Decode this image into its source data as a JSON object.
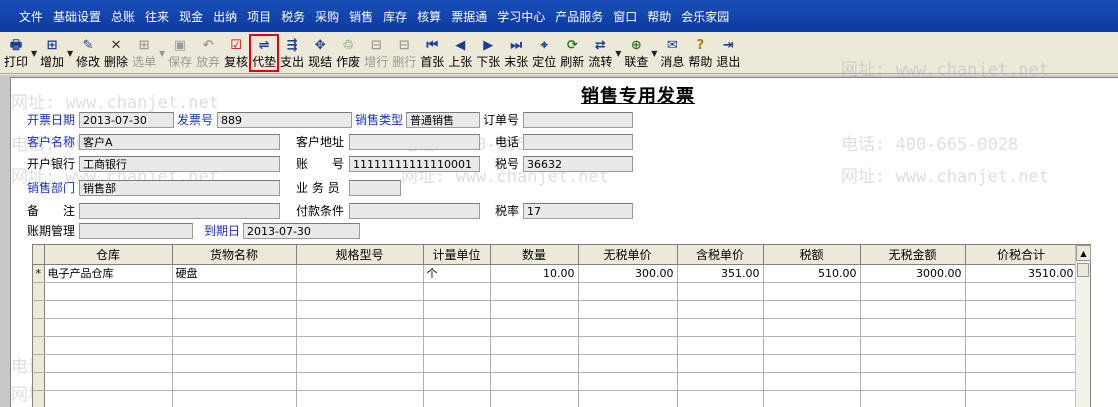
{
  "menu": [
    "文件",
    "基础设置",
    "总账",
    "往来",
    "现金",
    "出纳",
    "项目",
    "税务",
    "采购",
    "销售",
    "库存",
    "核算",
    "票据通",
    "学习中心",
    "产品服务",
    "窗口",
    "帮助",
    "会乐家园"
  ],
  "toolbar": {
    "print": "打印",
    "add": "增加",
    "modify": "修改",
    "delete": "删除",
    "select": "选单",
    "save": "保存",
    "discard": "放弃",
    "review": "复核",
    "advance": "代垫",
    "expense": "支出",
    "settle": "现结",
    "void": "作废",
    "add_row": "增行",
    "delete_row": "删行",
    "first": "首张",
    "prev": "上张",
    "next": "下张",
    "last": "末张",
    "locate": "定位",
    "refresh": "刷新",
    "flow": "流转",
    "link": "联查",
    "message": "消息",
    "help": "帮助",
    "exit": "退出"
  },
  "form": {
    "title": "销售专用发票",
    "invoice_date_label": "开票日期",
    "invoice_date": "2013-07-30",
    "invoice_no_label": "发票号",
    "invoice_no": "889",
    "sales_type_label": "销售类型",
    "sales_type": "普通销售",
    "order_no_label": "订单号",
    "order_no": "",
    "customer_label": "客户名称",
    "customer": "客户A",
    "address_label": "客户地址",
    "address": "",
    "phone_label": "电话",
    "phone": "",
    "bank_label": "开户银行",
    "bank": "工商银行",
    "account_label": "账　　号",
    "account": "11111111111110001",
    "tax_no_label": "税号",
    "tax_no": "36632",
    "dept_label": "销售部门",
    "dept": "销售部",
    "salesman_label": "业 务 员",
    "salesman": "",
    "remark_label": "备　　注",
    "remark": "",
    "payment_label": "付款条件",
    "payment": "",
    "tax_rate_label": "税率",
    "tax_rate": "17",
    "period_label": "账期管理",
    "period": "",
    "due_label": "到期日",
    "due": "2013-07-30"
  },
  "grid": {
    "columns": [
      "仓库",
      "货物名称",
      "规格型号",
      "计量单位",
      "数量",
      "无税单价",
      "含税单价",
      "税额",
      "无税金额",
      "价税合计"
    ],
    "rows": [
      {
        "marker": "*",
        "warehouse": "电子产品仓库",
        "goods": "硬盘",
        "spec": "",
        "unit": "个",
        "qty": "10.00",
        "price": "300.00",
        "tax_price": "351.00",
        "tax": "510.00",
        "amount": "3000.00",
        "total": "3510.00"
      }
    ]
  },
  "watermark": {
    "phone": "电话: 400-665-0028",
    "site": "网址: www.chanjet.net"
  },
  "colors": {
    "menubar": "#0b3aa0",
    "label_blue": "#1a2fbf",
    "highlight": "#e0000f"
  }
}
